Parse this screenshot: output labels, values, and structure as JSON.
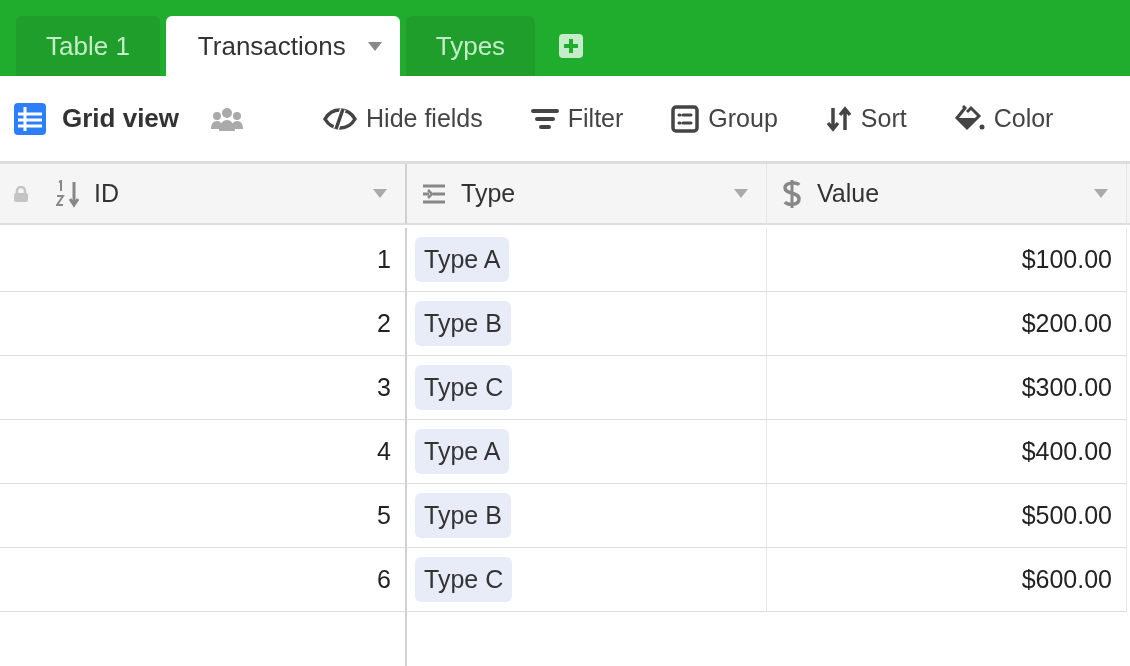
{
  "tabs": [
    {
      "label": "Table 1",
      "selected": false
    },
    {
      "label": "Transactions",
      "selected": true
    },
    {
      "label": "Types",
      "selected": false
    }
  ],
  "toolbar": {
    "view_name": "Grid view",
    "actions": [
      {
        "label": "Hide fields"
      },
      {
        "label": "Filter"
      },
      {
        "label": "Group"
      },
      {
        "label": "Sort"
      },
      {
        "label": "Color"
      }
    ]
  },
  "table": {
    "columns": [
      {
        "name": "ID",
        "kind": "number"
      },
      {
        "name": "Type",
        "kind": "select"
      },
      {
        "name": "Value",
        "kind": "currency"
      }
    ],
    "rows": [
      {
        "id": "1",
        "type": "Type A",
        "value": "$100.00"
      },
      {
        "id": "2",
        "type": "Type B",
        "value": "$200.00"
      },
      {
        "id": "3",
        "type": "Type C",
        "value": "$300.00"
      },
      {
        "id": "4",
        "type": "Type A",
        "value": "$400.00"
      },
      {
        "id": "5",
        "type": "Type B",
        "value": "$500.00"
      },
      {
        "id": "6",
        "type": "Type C",
        "value": "$600.00"
      }
    ]
  }
}
